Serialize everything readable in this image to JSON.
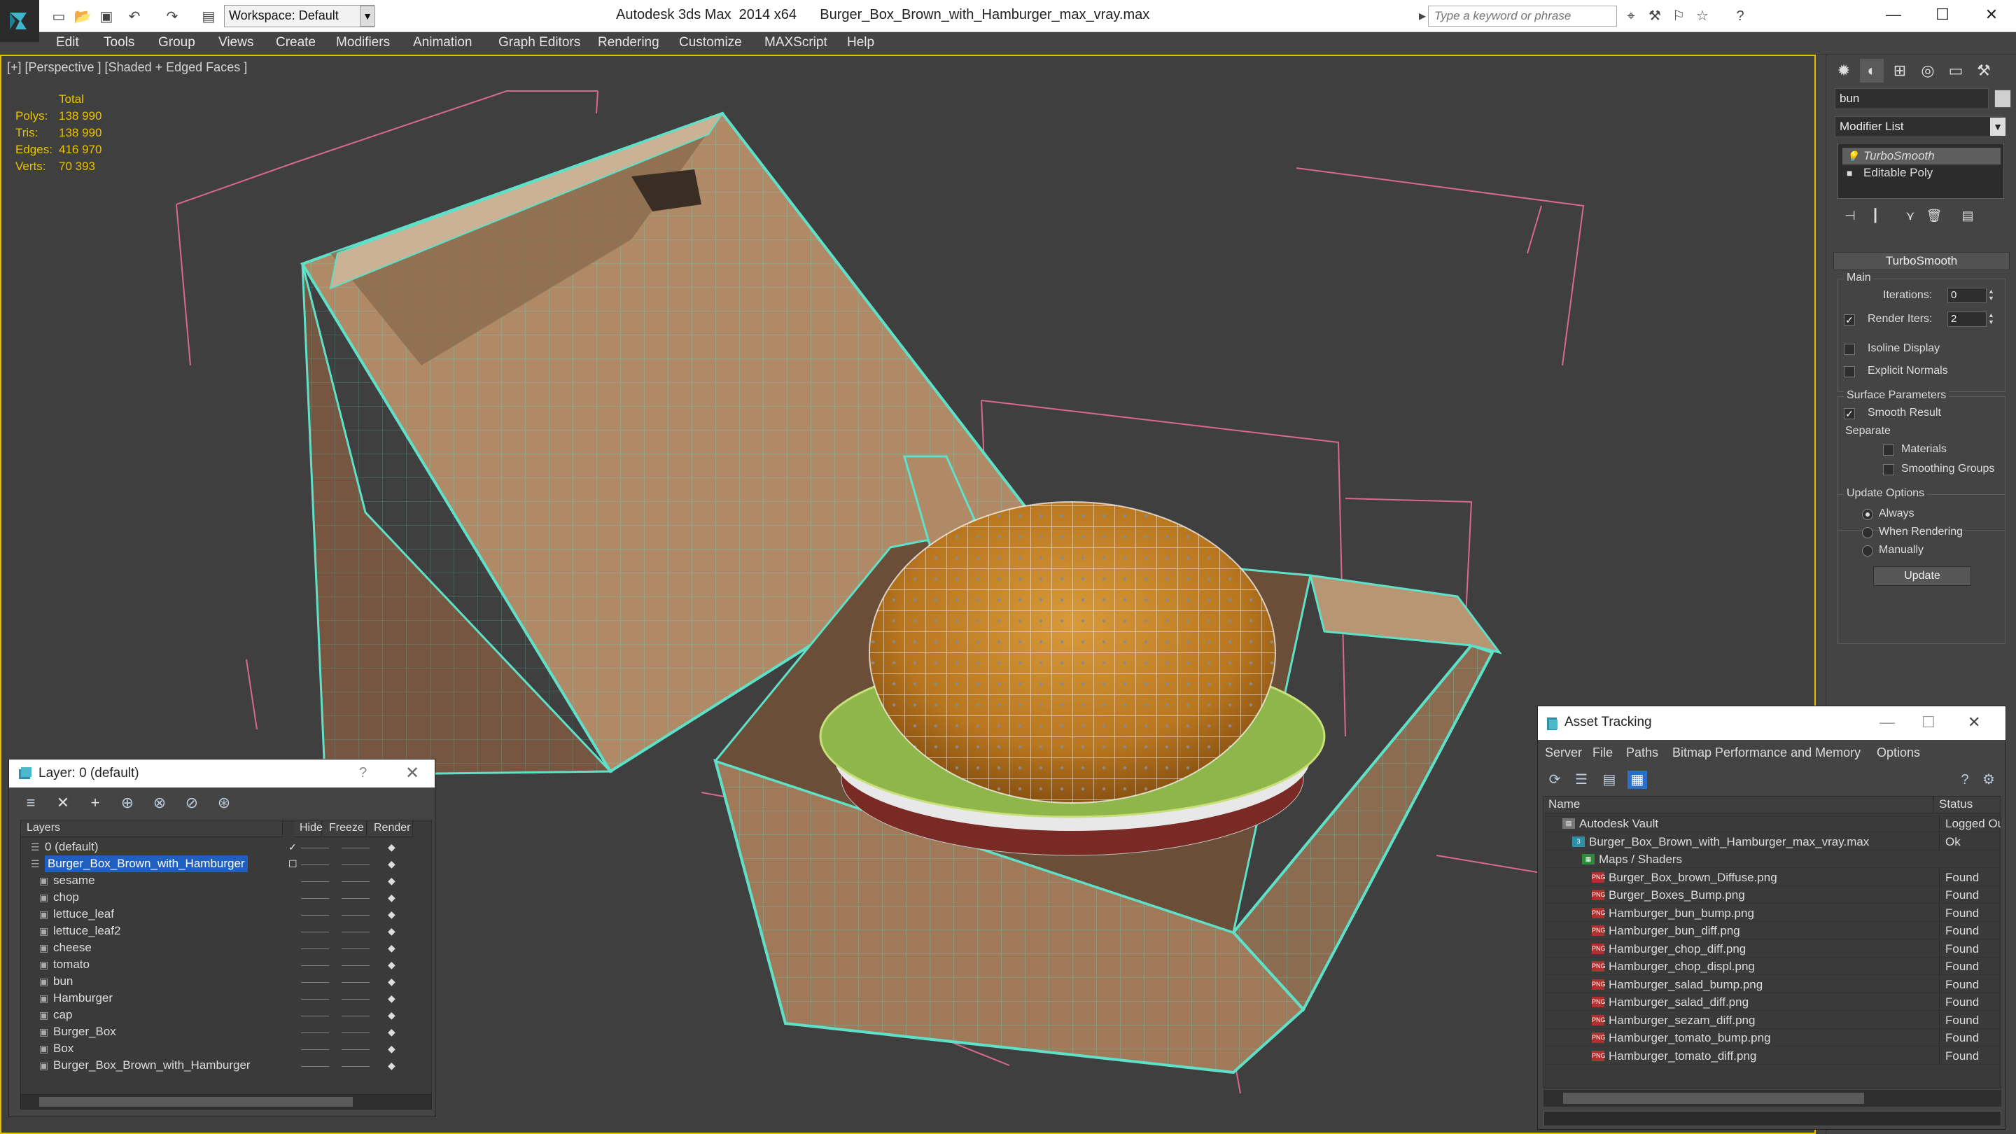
{
  "app": {
    "window_title": "Autodesk 3ds Max  2014 x64      Burger_Box_Brown_with_Hamburger_max_vray.max",
    "workspace": "Workspace: Default",
    "search_placeholder": "Type a keyword or phrase"
  },
  "menu": [
    "Edit",
    "Tools",
    "Group",
    "Views",
    "Create",
    "Modifiers",
    "Animation",
    "Graph Editors",
    "Rendering",
    "Customize",
    "MAXScript",
    "Help"
  ],
  "viewport": {
    "label": "[+] [Perspective ] [Shaded + Edged Faces ]",
    "stats": {
      "header": "Total",
      "rows": [
        {
          "k": "Polys:",
          "v": "138 990"
        },
        {
          "k": "Tris:",
          "v": "138 990"
        },
        {
          "k": "Edges:",
          "v": "416 970"
        },
        {
          "k": "Verts:",
          "v": "70 393"
        }
      ]
    }
  },
  "command_panel": {
    "object_name": "bun",
    "modifier_list": "Modifier List",
    "stack": [
      "TurboSmooth",
      "Editable Poly"
    ],
    "rollout": "TurboSmooth",
    "main_group": "Main",
    "iterations_label": "Iterations:",
    "iterations_value": "0",
    "render_iters_label": "Render Iters:",
    "render_iters_value": "2",
    "isoline": "Isoline Display",
    "explicit_normals": "Explicit Normals",
    "surface_group": "Surface Parameters",
    "smooth_result": "Smooth Result",
    "separate": "Separate",
    "materials": "Materials",
    "smoothing_groups": "Smoothing Groups",
    "update_group": "Update Options",
    "always": "Always",
    "when_rendering": "When Rendering",
    "manually": "Manually",
    "update_button": "Update"
  },
  "layer_window": {
    "title": "Layer: 0 (default)",
    "help": "?",
    "columns": {
      "layers": "Layers",
      "hide": "Hide",
      "freeze": "Freeze",
      "render": "Render"
    },
    "rows": [
      {
        "name": "0 (default)",
        "level": 1
      },
      {
        "name": "Burger_Box_Brown_with_Hamburger",
        "level": 1
      },
      {
        "name": "sesame",
        "level": 2
      },
      {
        "name": "chop",
        "level": 2
      },
      {
        "name": "lettuce_leaf",
        "level": 2
      },
      {
        "name": "lettuce_leaf2",
        "level": 2
      },
      {
        "name": "cheese",
        "level": 2
      },
      {
        "name": "tomato",
        "level": 2
      },
      {
        "name": "bun",
        "level": 2
      },
      {
        "name": "Hamburger",
        "level": 2
      },
      {
        "name": "cap",
        "level": 2
      },
      {
        "name": "Burger_Box",
        "level": 2
      },
      {
        "name": "Box",
        "level": 2
      },
      {
        "name": "Burger_Box_Brown_with_Hamburger",
        "level": 2
      }
    ]
  },
  "asset_window": {
    "title": "Asset Tracking",
    "menu": [
      "Server",
      "File",
      "Paths",
      "Bitmap Performance and Memory",
      "Options"
    ],
    "columns": {
      "name": "Name",
      "status": "Status"
    },
    "rows": [
      {
        "name": "Autodesk Vault",
        "status": "Logged Ou",
        "indent": 28,
        "icon": "vault"
      },
      {
        "name": "Burger_Box_Brown_with_Hamburger_max_vray.max",
        "status": "Ok",
        "indent": 42,
        "icon": "max"
      },
      {
        "name": "Maps / Shaders",
        "status": "",
        "indent": 56,
        "icon": "folder"
      },
      {
        "name": "Burger_Box_brown_Diffuse.png",
        "status": "Found",
        "indent": 70,
        "icon": "png"
      },
      {
        "name": "Burger_Boxes_Bump.png",
        "status": "Found",
        "indent": 70,
        "icon": "png"
      },
      {
        "name": "Hamburger_bun_bump.png",
        "status": "Found",
        "indent": 70,
        "icon": "png"
      },
      {
        "name": "Hamburger_bun_diff.png",
        "status": "Found",
        "indent": 70,
        "icon": "png"
      },
      {
        "name": "Hamburger_chop_diff.png",
        "status": "Found",
        "indent": 70,
        "icon": "png"
      },
      {
        "name": "Hamburger_chop_displ.png",
        "status": "Found",
        "indent": 70,
        "icon": "png"
      },
      {
        "name": "Hamburger_salad_bump.png",
        "status": "Found",
        "indent": 70,
        "icon": "png"
      },
      {
        "name": "Hamburger_salad_diff.png",
        "status": "Found",
        "indent": 70,
        "icon": "png"
      },
      {
        "name": "Hamburger_sezam_diff.png",
        "status": "Found",
        "indent": 70,
        "icon": "png"
      },
      {
        "name": "Hamburger_tomato_bump.png",
        "status": "Found",
        "indent": 70,
        "icon": "png"
      },
      {
        "name": "Hamburger_tomato_diff.png",
        "status": "Found",
        "indent": 70,
        "icon": "png"
      }
    ]
  },
  "colors": {
    "viewport_bg": "#3f3f3f",
    "wire_selected": "#5fe0c8",
    "bbox_lines": "#d86a8c",
    "stats_text": "#e8c300",
    "selection": "#1f5fc0"
  }
}
